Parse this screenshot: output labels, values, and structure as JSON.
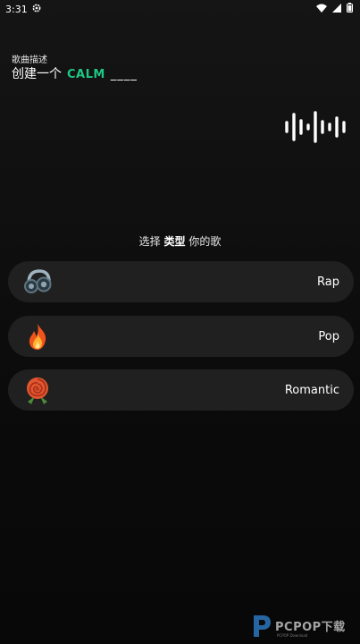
{
  "status_bar": {
    "time": "3:31"
  },
  "header": {
    "description_label": "歌曲描述",
    "prompt_prefix": "创建一个",
    "mood": "CALM",
    "blank": "____"
  },
  "section": {
    "choose_prefix": "选择",
    "choose_bold": "类型",
    "choose_suffix": "你的歌"
  },
  "genres": [
    {
      "label": "Rap",
      "icon": "headphones-icon"
    },
    {
      "label": "Pop",
      "icon": "fire-icon"
    },
    {
      "label": "Romantic",
      "icon": "rose-icon"
    }
  ],
  "watermark": {
    "text": "PCPOP下载",
    "sub": "PCPOP Download"
  },
  "colors": {
    "accent": "#1ec782",
    "card": "#202020",
    "background": "#0b0b0b"
  }
}
